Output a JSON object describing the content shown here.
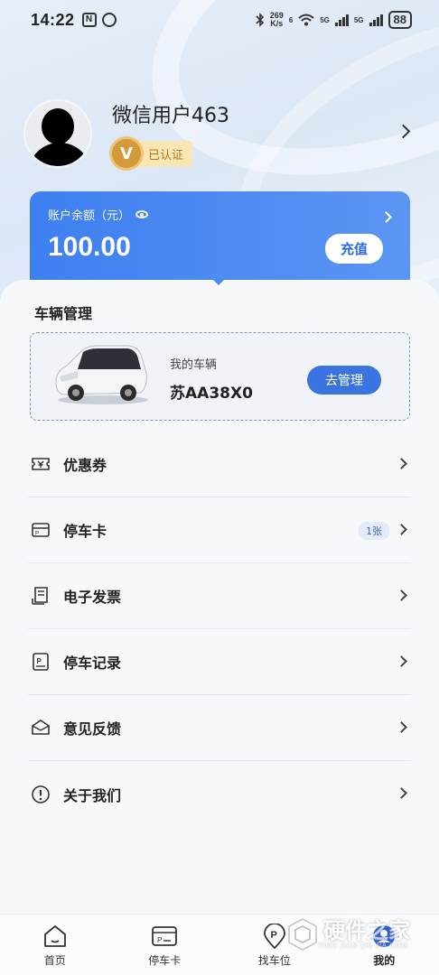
{
  "status_bar": {
    "time": "14:22",
    "nfc_icon": "N",
    "net_speed_value": "269",
    "net_speed_unit": "K/s",
    "wifi_sub": "6",
    "sim1": "5G",
    "sim2": "5G",
    "battery": "88"
  },
  "profile": {
    "username": "微信用户463",
    "verify_badge": "V",
    "verified_label": "已认证"
  },
  "balance": {
    "label": "账户余额（元）",
    "amount": "100.00",
    "recharge_label": "充值"
  },
  "vehicle": {
    "section_title": "车辆管理",
    "label": "我的车辆",
    "plate": "苏AA38X0",
    "manage_label": "去管理"
  },
  "menu": [
    {
      "label": "优惠券",
      "icon": "coupon-icon"
    },
    {
      "label": "停车卡",
      "icon": "parking-card-icon",
      "badge": "1张"
    },
    {
      "label": "电子发票",
      "icon": "invoice-icon"
    },
    {
      "label": "停车记录",
      "icon": "parking-record-icon"
    },
    {
      "label": "意见反馈",
      "icon": "feedback-icon"
    },
    {
      "label": "关于我们",
      "icon": "info-icon"
    }
  ],
  "tabs": [
    {
      "label": "首页",
      "icon": "home-icon"
    },
    {
      "label": "停车卡",
      "icon": "parking-card-icon"
    },
    {
      "label": "找车位",
      "icon": "parking-location-icon"
    },
    {
      "label": "我的",
      "icon": "profile-icon",
      "active": true
    }
  ],
  "watermark": {
    "title": "硬件之家",
    "subtitle": "YING JIAN ZHI JIA.COM"
  },
  "colors": {
    "primary": "#3a74e0",
    "badge_gold": "#d39a3a"
  }
}
